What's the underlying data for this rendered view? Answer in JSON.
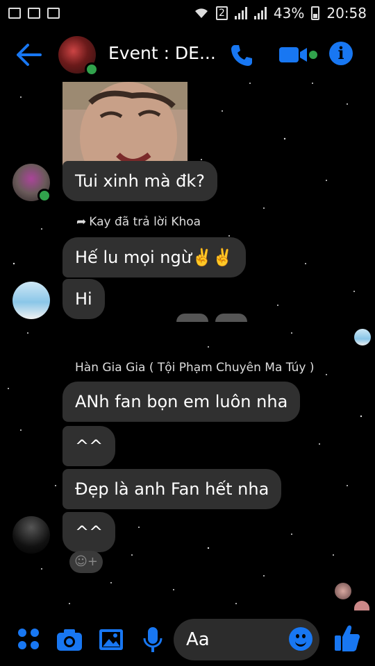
{
  "status_bar": {
    "battery": "43%",
    "time": "20:58",
    "sim": "2"
  },
  "header": {
    "title": "Event : DE..."
  },
  "messages": {
    "m1": "Tui xinh mà đk?",
    "reply_caption": "Kay đã trả lời Khoa",
    "m2": "Hế lu mọi ngừ✌️✌️",
    "m3": "Hi",
    "sender_name": "Hàn Gia Gia ( Tội Phạm Chuyên Ma Túy )",
    "m4": "ANh fan bọn em luôn nha",
    "m5": "^^",
    "m6": "Đẹp là anh Fan hết nha",
    "m7": "^^"
  },
  "composer": {
    "placeholder": "Aa"
  },
  "colors": {
    "accent": "#1877f2",
    "bubble": "#303030",
    "online": "#31a24c"
  }
}
